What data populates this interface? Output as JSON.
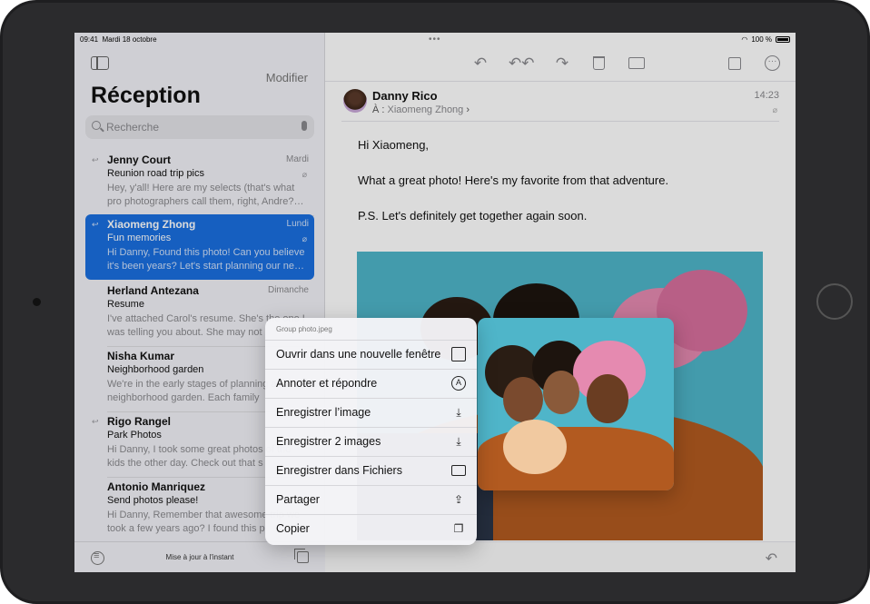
{
  "status": {
    "time": "09:41",
    "date": "Mardi 18 octobre",
    "battery": "100 %"
  },
  "list": {
    "edit_label": "Modifier",
    "title": "Réception",
    "search_placeholder": "Recherche",
    "messages": [
      {
        "sender": "Jenny Court",
        "date": "Mardi",
        "subject": "Reunion road trip pics",
        "preview": "Hey, y'all! Here are my selects (that's what pro photographers call them, right, Andre?…",
        "replied": true,
        "attachment": true,
        "selected": false
      },
      {
        "sender": "Xiaomeng Zhong",
        "date": "Lundi",
        "subject": "Fun memories",
        "preview": "Hi Danny, Found this photo! Can you believe it's been years? Let's start planning our ne…",
        "replied": true,
        "attachment": true,
        "selected": true
      },
      {
        "sender": "Herland Antezana",
        "date": "Dimanche",
        "subject": "Resume",
        "preview": "I've attached Carol's resume. She's the one I was telling you about. She may not",
        "replied": false,
        "attachment": false,
        "selected": false
      },
      {
        "sender": "Nisha Kumar",
        "date": "",
        "subject": "Neighborhood garden",
        "preview": "We're in the early stages of planning a neighborhood garden. Each family",
        "replied": false,
        "attachment": false,
        "selected": false
      },
      {
        "sender": "Rigo Rangel",
        "date": "",
        "subject": "Park Photos",
        "preview": "Hi Danny, I took some great photos of the kids the other day. Check out that s",
        "replied": true,
        "attachment": false,
        "selected": false
      },
      {
        "sender": "Antonio Manriquez",
        "date": "",
        "subject": "Send photos please!",
        "preview": "Hi Danny, Remember that awesome trip we took a few years ago? I found this p",
        "replied": false,
        "attachment": false,
        "selected": false
      }
    ],
    "updated_text": "Mise à jour à l'instant"
  },
  "mail": {
    "from": "Danny Rico",
    "to_prefix": "À :",
    "to_name": "Xiaomeng Zhong",
    "time": "14:23",
    "body": [
      "Hi Xiaomeng,",
      "What a great photo! Here's my favorite from that adventure.",
      "P.S. Let's definitely get together again soon."
    ]
  },
  "menu": {
    "title": "Group photo.jpeg",
    "items": [
      {
        "label": "Ouvrir dans une nouvelle fenêtre",
        "icon": "new-window-icon"
      },
      {
        "label": "Annoter et répondre",
        "icon": "markup-icon"
      },
      {
        "label": "Enregistrer l’image",
        "icon": "save-image-icon"
      },
      {
        "label": "Enregistrer 2 images",
        "icon": "save-images-icon"
      },
      {
        "label": "Enregistrer dans Fichiers",
        "icon": "folder-icon"
      },
      {
        "label": "Partager",
        "icon": "share-icon"
      },
      {
        "label": "Copier",
        "icon": "copy-icon"
      }
    ]
  },
  "colors": {
    "accent": "#1a6fe0",
    "photo_bg": "#4fb5c9",
    "list_bg": "#f2f2f7"
  }
}
